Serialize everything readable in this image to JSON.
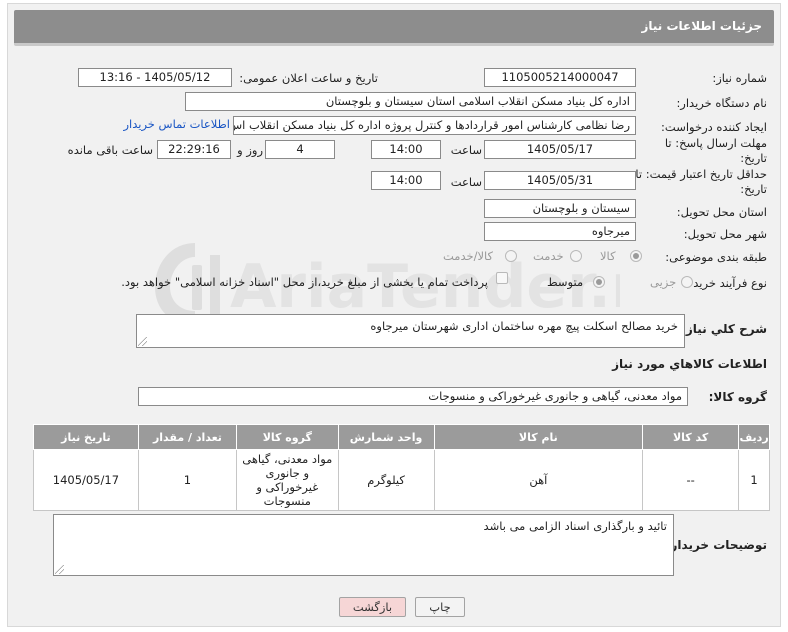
{
  "header": {
    "title": "جزئیات اطلاعات نیاز"
  },
  "form": {
    "need_number_label": "شماره نیاز:",
    "need_number": "1105005214000047",
    "announce_label": "تاریخ و ساعت اعلان عمومی:",
    "announce_value": "1405/05/12 - 13:16",
    "buyer_org_label": "نام دستگاه خریدار:",
    "buyer_org": "اداره کل بنیاد مسکن انقلاب اسلامی استان سیستان و بلوچستان",
    "requester_label": "ایجاد کننده درخواست:",
    "requester": "رضا نظامی کارشناس امور قراردادها و کنترل پروژه اداره کل بنیاد مسکن انقلاب اس",
    "buyer_contact_link": "اطلاعات تماس خریدار",
    "reply_deadline_label": "مهلت ارسال پاسخ: تا تاریخ:",
    "reply_date": "1405/05/17",
    "time_label": "ساعت",
    "reply_time": "14:00",
    "days_value": "4",
    "days_label": "روز و",
    "remaining_time": "22:29:16",
    "remaining_label": "ساعت باقی مانده",
    "price_deadline_label": "حداقل تاریخ اعتبار قیمت: تا تاریخ:",
    "price_date": "1405/05/31",
    "price_time": "14:00",
    "province_label": "استان محل تحویل:",
    "province": "سیستان و بلوچستان",
    "city_label": "شهر محل تحویل:",
    "city": "میرجاوه",
    "category_label": "طبقه بندی موضوعی:",
    "category_options": [
      "کالا",
      "خدمت",
      "کالا/خدمت"
    ],
    "category_selected": "کالا",
    "process_label": "نوع فرآیند خرید :",
    "process_options": [
      "جزیی",
      "متوسط"
    ],
    "process_selected": "متوسط",
    "payment_note": "پرداخت تمام یا بخشی از مبلغ خرید،از محل \"اسناد خزانه اسلامی\" خواهد بود."
  },
  "description": {
    "label": "شرح کلي نياز:",
    "text": "خرید مصالح اسکلت پیچ مهره ساختمان اداری شهرستان میرجاوه"
  },
  "goods": {
    "section_title": "اطلاعات کالاهاي مورد نياز",
    "group_label": "گروه کالا:",
    "group_value": "مواد معدنی، گیاهی و جانوری غیرخوراکی و منسوجات",
    "columns": [
      "رديف",
      "کد کالا",
      "نام کالا",
      "واحد شمارش",
      "گروه کالا",
      "تعداد / مقدار",
      "تاریخ نیاز"
    ],
    "rows": [
      [
        "1",
        "--",
        "آهن",
        "کیلوگرم",
        "مواد معدنی، گیاهی و جانوری غیرخوراکی و منسوجات",
        "1",
        "1405/05/17"
      ]
    ]
  },
  "buyer_notes": {
    "label": "توضیحات خریدار:",
    "text": "تائید و بارگذاری اسناد الزامی می باشد"
  },
  "buttons": {
    "print": "چاپ",
    "back": "بازگشت"
  },
  "watermark": {
    "text": "AriaTender.neT"
  },
  "colors": {
    "header_bg": "#8d8d8d",
    "table_header_bg": "#9b9b9b",
    "link": "#1a56c4",
    "back_button": "#f6d6d6"
  }
}
